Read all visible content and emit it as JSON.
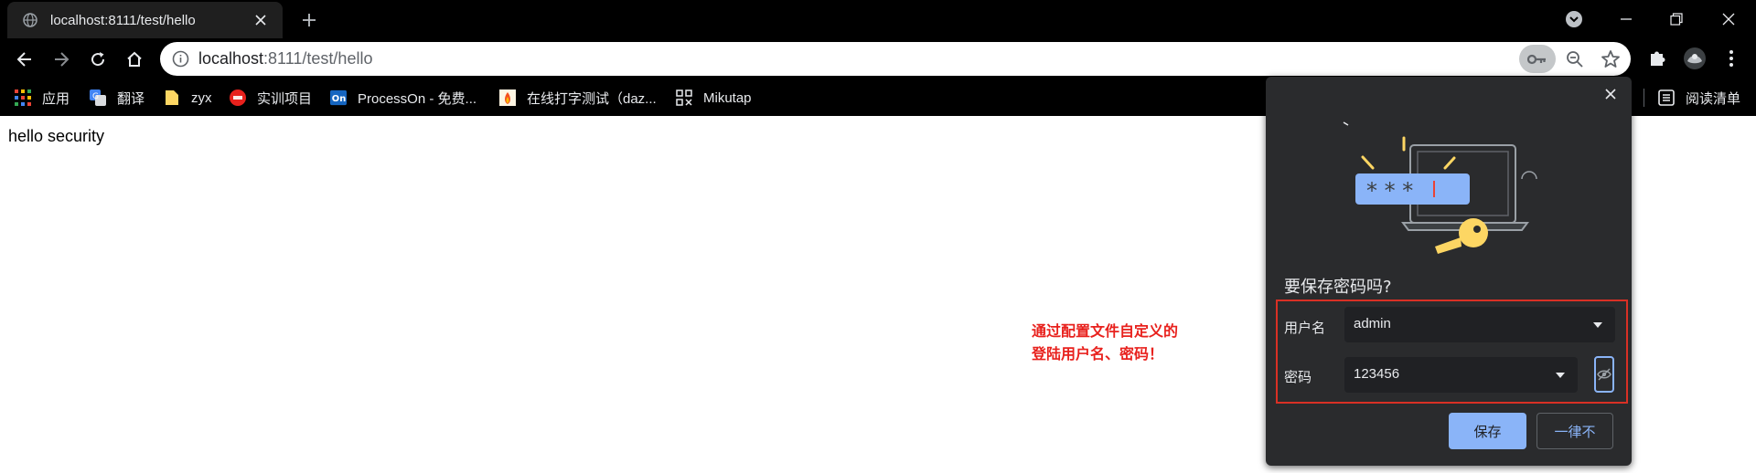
{
  "browser": {
    "tab": {
      "title": "localhost:8111/test/hello",
      "favicon": "globe-icon"
    },
    "omnibox": {
      "host": "localhost",
      "path": ":8111/test/hello"
    }
  },
  "bookmarks": [
    {
      "label": "应用",
      "icon": "apps-grid-icon"
    },
    {
      "label": "翻译",
      "icon": "translate-icon"
    },
    {
      "label": "zyx",
      "icon": "folder-icon"
    },
    {
      "label": "实训项目",
      "icon": "toutiao-icon"
    },
    {
      "label": "ProcessOn - 免费...",
      "icon": "processon-icon"
    },
    {
      "label": "在线打字测试（daz...",
      "icon": "typing-test-icon"
    },
    {
      "label": "Mikutap",
      "icon": "mikutap-icon"
    }
  ],
  "reading_list": {
    "label": "阅读清单"
  },
  "page": {
    "text": "hello security"
  },
  "annotation": {
    "line1": "通过配置文件自定义的",
    "line2": "登陆用户名、密码！"
  },
  "popup": {
    "heading": "要保存密码吗?",
    "username_label": "用户名",
    "username_value": "admin",
    "password_label": "密码",
    "password_value": "123456",
    "save_label": "保存",
    "never_label": "一律不"
  },
  "colors": {
    "accent": "#8ab4f8",
    "annotation_red": "#e8211d",
    "popup_bg": "#2a2b2d"
  }
}
